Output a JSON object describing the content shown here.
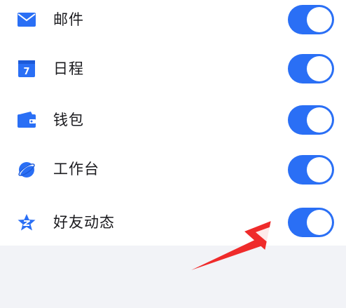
{
  "accent_color": "#2a6ff5",
  "items": [
    {
      "icon": "mail-icon",
      "label": "邮件",
      "enabled": true
    },
    {
      "icon": "calendar-icon",
      "icon_text": "7",
      "label": "日程",
      "enabled": true
    },
    {
      "icon": "wallet-icon",
      "label": "钱包",
      "enabled": true
    },
    {
      "icon": "planet-icon",
      "label": "工作台",
      "enabled": true
    },
    {
      "icon": "qzone-star-icon",
      "label": "好友动态",
      "enabled": true
    }
  ],
  "annotation": {
    "type": "arrow",
    "color": "#ef2b2b",
    "points_to": "好友动态 toggle"
  }
}
